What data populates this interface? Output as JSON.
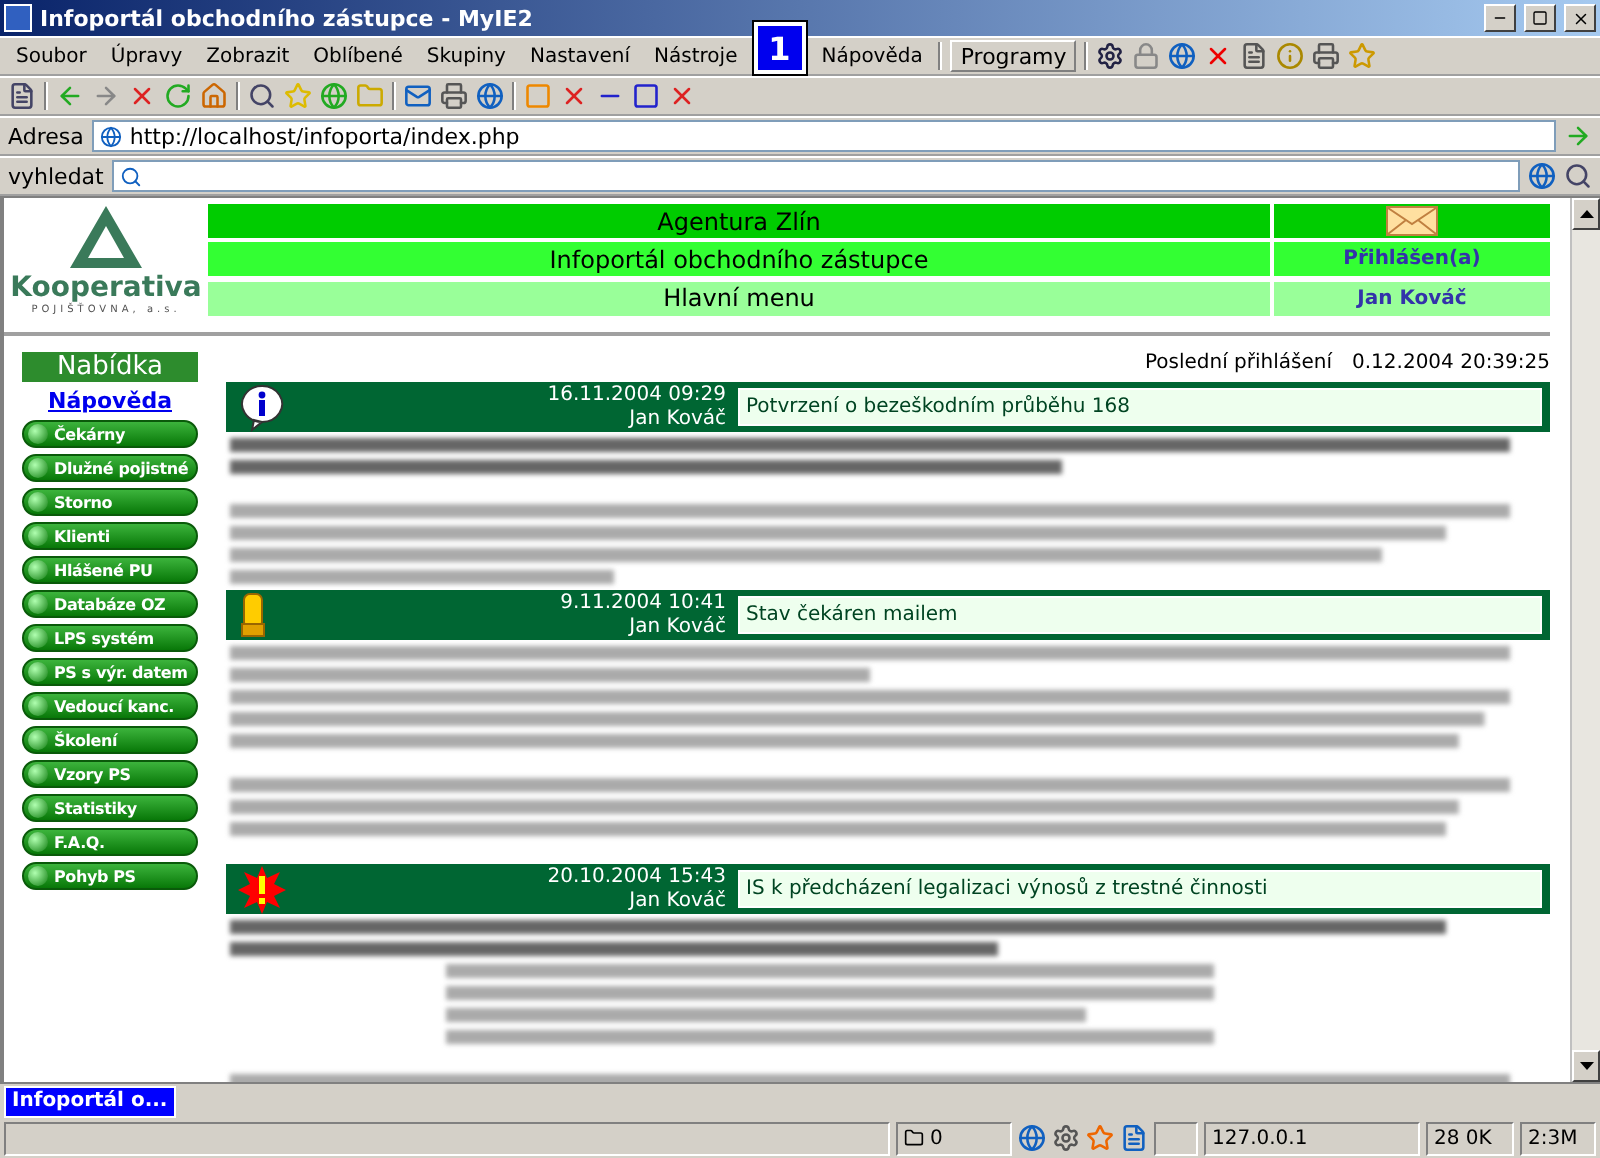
{
  "window": {
    "title": "Infoportál obchodního zástupce - MyIE2"
  },
  "menu": [
    "Soubor",
    "Úpravy",
    "Zobrazit",
    "Oblíbené",
    "Skupiny",
    "Nastavení",
    "Nástroje",
    "Nápověda"
  ],
  "badge": "1",
  "programs_button": "Programy",
  "address": {
    "label": "Adresa",
    "value": "http://localhost/infoporta/index.php"
  },
  "search": {
    "label": "vyhledat"
  },
  "header": {
    "rows": [
      {
        "title": "Agentura Zlín",
        "kind": "mail"
      },
      {
        "title": "Infoportál obchodního zástupce",
        "side": "Přihlášen(a)",
        "kind": "link"
      },
      {
        "title": "Hlavní menu",
        "side": "Jan Kováč",
        "kind": "link"
      }
    ]
  },
  "logo": {
    "name": "Kooperativa",
    "tagline": "POJIŠŤOVNA, a.s."
  },
  "sidebar": {
    "title": "Nabídka",
    "help": "Nápověda",
    "items": [
      "Čekárny",
      "Dlužné pojistné",
      "Storno",
      "Klienti",
      "Hlášené PU",
      "Databáze OZ",
      "LPS systém",
      "PS s výr. datem",
      "Vedoucí kanc.",
      "Školení",
      "Vzory PS",
      "Statistiky",
      "F.A.Q.",
      "Pohyb PS"
    ]
  },
  "last_login": {
    "label": "Poslední přihlášení",
    "value": "0.12.2004 20:39:25"
  },
  "news": [
    {
      "kind": "info",
      "date": "16.11.2004 09:29",
      "author": "Jan Kováč",
      "title": "Potvrzení o bezeškodním průběhu 168"
    },
    {
      "kind": "mail",
      "date": "9.11.2004 10:41",
      "author": "Jan Kováč",
      "title": "Stav čekáren mailem"
    },
    {
      "kind": "alert",
      "date": "20.10.2004 15:43",
      "author": "Jan Kováč",
      "title": "IS k předcházení legalizaci výnosů z trestné činnosti"
    }
  ],
  "tabs": [
    {
      "label": "Infoportál o...",
      "selected": true
    }
  ],
  "status": {
    "count": "0",
    "ip": "127.0.0.1",
    "size": "28 0K",
    "memory": "2:3M"
  }
}
